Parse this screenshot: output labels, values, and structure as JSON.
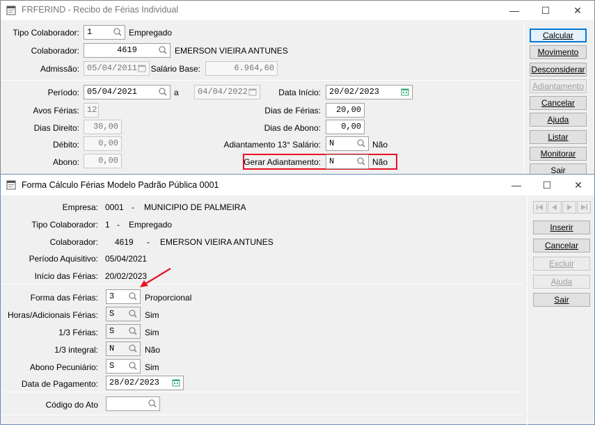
{
  "back_window": {
    "title": "FRFERIND - Recibo de Férias Individual",
    "window_controls": {
      "minimize": "—",
      "maximize": "☐",
      "close": "✕"
    },
    "tipo_colaborador": {
      "label": "Tipo Colaborador:",
      "value": "1",
      "desc": "Empregado"
    },
    "colaborador": {
      "label": "Colaborador:",
      "value": "4619",
      "name": "EMERSON VIEIRA ANTUNES"
    },
    "admissao": {
      "label": "Admissão:",
      "value": "05/04/2011"
    },
    "salario_base": {
      "label": "Salário Base:",
      "value": "6.964,60"
    },
    "periodo": {
      "label": "Período:",
      "from": "05/04/2021",
      "separator": "a",
      "to": "04/04/2022"
    },
    "data_inicio": {
      "label": "Data Início:",
      "value": "20/02/2023"
    },
    "avos_ferias": {
      "label": "Avos Férias:",
      "value": "12"
    },
    "dias_ferias": {
      "label": "Dias de Férias:",
      "value": "20,00"
    },
    "dias_direito": {
      "label": "Dias Direito:",
      "value": "30,00"
    },
    "dias_abono": {
      "label": "Dias de Abono:",
      "value": "0,00"
    },
    "debito": {
      "label": "Débito:",
      "value": "0,00"
    },
    "adiantamento_13": {
      "label": "Adiantamento 13° Salário:",
      "value": "N",
      "desc": "Não"
    },
    "abono": {
      "label": "Abono:",
      "value": "0,00"
    },
    "gerar_adiantamento": {
      "label": "Gerar Adiantamento:",
      "value": "N",
      "desc": "Não"
    },
    "buttons": [
      {
        "label": "Calcular",
        "state": "default"
      },
      {
        "label": "Movimento",
        "state": "normal"
      },
      {
        "label": "Desconsiderar",
        "state": "normal"
      },
      {
        "label": "Adiantamento",
        "state": "disabled"
      },
      {
        "label": "Cancelar",
        "state": "normal"
      },
      {
        "label": "Ajuda",
        "state": "normal"
      },
      {
        "label": "Listar",
        "state": "normal"
      },
      {
        "label": "Monitorar",
        "state": "normal"
      },
      {
        "label": "Sair",
        "state": "normal"
      }
    ],
    "highlight_color": "#e81123"
  },
  "dialog": {
    "title": "Forma Cálculo Férias Modelo Padrão Pública 0001",
    "window_controls": {
      "minimize": "—",
      "maximize": "☐",
      "close": "✕"
    },
    "empresa": {
      "label": "Empresa:",
      "code": "0001",
      "dash": "-",
      "name": "MUNICIPIO DE PALMEIRA"
    },
    "tipo_colaborador": {
      "label": "Tipo Colaborador:",
      "code": "1",
      "dash": "-",
      "name": "Empregado"
    },
    "colaborador": {
      "label": "Colaborador:",
      "code": "4619",
      "dash": "-",
      "name": "EMERSON VIEIRA ANTUNES"
    },
    "periodo_aquisitivo": {
      "label": "Período Aquisitivo:",
      "value": "05/04/2021"
    },
    "inicio_ferias": {
      "label": "Início das Férias:",
      "value": "20/02/2023"
    },
    "forma_ferias": {
      "label": "Forma das Férias:",
      "value": "3",
      "desc": "Proporcional"
    },
    "horas_adicionais": {
      "label": "Horas/Adicionais Férias:",
      "value": "S",
      "desc": "Sim"
    },
    "um_terco_ferias": {
      "label": "1/3 Férias:",
      "value": "S",
      "desc": "Sim"
    },
    "um_terco_integral": {
      "label": "1/3 integral:",
      "value": "N",
      "desc": "Não"
    },
    "abono_pecuniario": {
      "label": "Abono Pecuniário:",
      "value": "S",
      "desc": "Sim"
    },
    "data_pagamento": {
      "label": "Data de Pagamento:",
      "value": "28/02/2023"
    },
    "codigo_ato": {
      "label": "Código do Ato",
      "value": ""
    },
    "nav_icons": [
      "first-record-icon",
      "previous-record-icon",
      "next-record-icon",
      "last-record-icon"
    ],
    "buttons": [
      {
        "label": "Inserir",
        "state": "normal"
      },
      {
        "label": "Cancelar",
        "state": "normal"
      },
      {
        "label": "Excluir",
        "state": "disabled"
      },
      {
        "label": "Ajuda",
        "state": "disabled"
      },
      {
        "label": "Sair",
        "state": "normal"
      }
    ],
    "arrow_color": "#e81123"
  }
}
